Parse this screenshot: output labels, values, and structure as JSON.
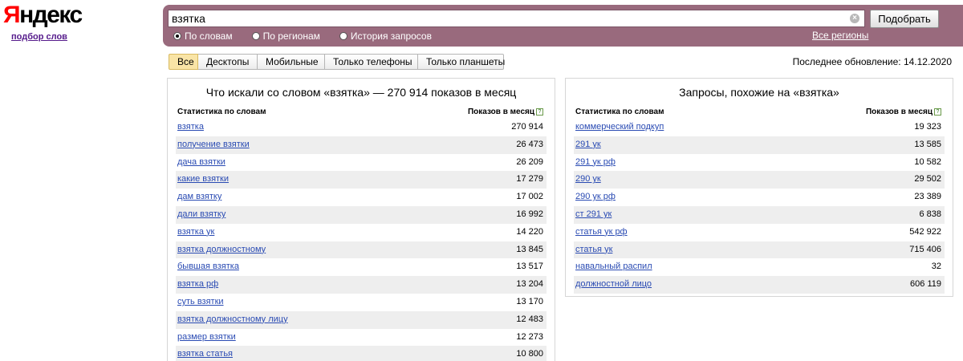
{
  "logo": {
    "mark_first": "Я",
    "mark_rest": "ндекс",
    "subtitle": "подбор слов"
  },
  "search": {
    "value": "взятка",
    "clear_glyph": "×",
    "button_label": "Подобрать"
  },
  "modes": [
    {
      "label": "По словам",
      "selected": true
    },
    {
      "label": "По регионам",
      "selected": false
    },
    {
      "label": "История запросов",
      "selected": false
    }
  ],
  "regions_link": "Все регионы",
  "tabs": [
    {
      "label": "Все",
      "active": true
    },
    {
      "label": "Десктопы",
      "active": false
    },
    {
      "label": "Мобильные",
      "active": false
    },
    {
      "label": "Только телефоны",
      "active": false
    },
    {
      "label": "Только планшеты",
      "active": false
    }
  ],
  "last_update": "Последнее обновление: 14.12.2020",
  "colors": {
    "header_bar": "#996a7d",
    "link": "#2a4bb3",
    "active_tab": "#f9e4a6",
    "row_alt": "#eeeeee"
  },
  "left_panel": {
    "title": "Что искали со словом «взятка» — 270 914 показов в месяц",
    "col_left": "Статистика по словам",
    "col_right": "Показов в месяц",
    "help_glyph": "?",
    "rows": [
      {
        "keyword": "взятка",
        "count": "270 914"
      },
      {
        "keyword": "получение взятки",
        "count": "26 473"
      },
      {
        "keyword": "дача взятки",
        "count": "26 209"
      },
      {
        "keyword": "какие взятки",
        "count": "17 279"
      },
      {
        "keyword": "дам взятку",
        "count": "17 002"
      },
      {
        "keyword": "дали взятку",
        "count": "16 992"
      },
      {
        "keyword": "взятка ук",
        "count": "14 220"
      },
      {
        "keyword": "взятка должностному",
        "count": "13 845"
      },
      {
        "keyword": "бывшая взятка",
        "count": "13 517"
      },
      {
        "keyword": "взятка рф",
        "count": "13 204"
      },
      {
        "keyword": "суть взятки",
        "count": "13 170"
      },
      {
        "keyword": "взятка должностному лицу",
        "count": "12 483"
      },
      {
        "keyword": "размер взятки",
        "count": "12 273"
      },
      {
        "keyword": "взятка статья",
        "count": "10 800"
      }
    ]
  },
  "right_panel": {
    "title": "Запросы, похожие на «взятка»",
    "col_left": "Статистика по словам",
    "col_right": "Показов в месяц",
    "help_glyph": "?",
    "rows": [
      {
        "keyword": "коммерческий подкуп",
        "count": "19 323"
      },
      {
        "keyword": "291 ук",
        "count": "13 585"
      },
      {
        "keyword": "291 ук рф",
        "count": "10 582"
      },
      {
        "keyword": "290 ук",
        "count": "29 502"
      },
      {
        "keyword": "290 ук рф",
        "count": "23 389"
      },
      {
        "keyword": "ст 291 ук",
        "count": "6 838"
      },
      {
        "keyword": "статья ук рф",
        "count": "542 922"
      },
      {
        "keyword": "статья ук",
        "count": "715 406"
      },
      {
        "keyword": "навальный распил",
        "count": "32"
      },
      {
        "keyword": "должностной лицо",
        "count": "606 119"
      }
    ]
  }
}
